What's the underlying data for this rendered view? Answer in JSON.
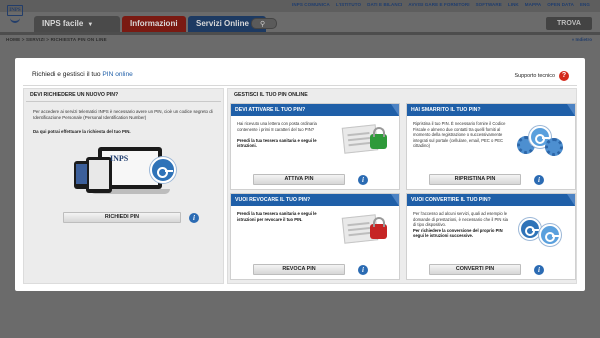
{
  "site": {
    "top_links": [
      "INPS COMUNICA",
      "L'ISTITUTO",
      "DATI E BILANCI",
      "AVVISI GARE E FORNITORI",
      "SOFTWARE",
      "LINK",
      "MAPPA",
      "OPEN DATA",
      "ENG"
    ],
    "logo_text": "INPS",
    "nav_tabs": [
      "INPS facile",
      "Informazioni",
      "Servizi Online"
    ],
    "search_button": "TROVA",
    "breadcrumb": "HOME > SERVIZI > RICHIESTA PIN ON LINE",
    "back_link": "« Indietro"
  },
  "modal": {
    "title_prefix": "Richiedi e gestisci il tuo ",
    "title_highlight": "PIN online",
    "support_label": "Supporto tecnico",
    "left": {
      "heading": "DEVI RICHIEDERE UN NUOVO PIN?",
      "text": "Per accedere ai servizi telematici INPS è necessario avere un PIN, cioè un codice segreto di Identificazione Personale (Personal Identification Number)",
      "bold_text": "Da qui potrai effettuare la richiesta del tuo PIN.",
      "button": "RICHIEDI PIN"
    },
    "right": {
      "heading": "GESTISCI IL TUO PIN ONLINE",
      "cards": [
        {
          "title": "DEVI ATTIVARE IL TUO PIN?",
          "text": "Hai ricevuto una lettera con posta ordinaria contenente i primi 8 caratteri del tuo PIN?",
          "bold": "Prendi la tua tessera sanitaria e segui le istruzioni.",
          "button": "ATTIVA PIN"
        },
        {
          "title": "HAI SMARRITO IL TUO PIN?",
          "text": "Ripristina il tuo PIN. È necessario fornire il Codice Fiscale e almeno due contatti tra quelli forniti al momento della registrazione o successivamente integrati sul portale (cellulare, email, PEC o PEC cittadino)",
          "bold": "",
          "button": "RIPRISTINA PIN"
        },
        {
          "title": "VUOI REVOCARE IL TUO PIN?",
          "text": "",
          "bold": "Prendi la tua tessera sanitaria e segui le istruzioni per revocare il tuo PIN.",
          "button": "REVOCA PIN"
        },
        {
          "title": "VUOI CONVERTIRE IL TUO PIN?",
          "text": "Per l'accesso ad alcuni servizi, quali ad esempio le domande di prestazioni, è necessario che il PIN sia di tipo dispositivo.",
          "bold": "Per richiedere la conversione del proprio PIN segui le istruzioni successive.",
          "button": "CONVERTI PIN"
        }
      ]
    },
    "icons": {
      "help": "help-icon",
      "info": "info-icon",
      "lock_green": "lock-icon",
      "lock_red": "lock-icon",
      "key": "key-icon"
    },
    "colors": {
      "accent_blue": "#1f5fa8",
      "help_red": "#d42a1c",
      "lock_green": "#2e9a3a",
      "lock_red": "#c62525"
    }
  }
}
